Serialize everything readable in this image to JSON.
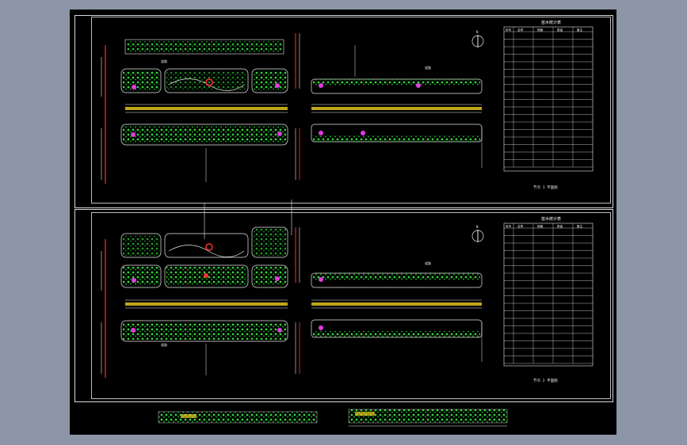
{
  "plans": [
    {
      "id": "upper",
      "north_symbol": "north-arrow",
      "legend_title": "苗木统计表",
      "legend_headers": [
        "序号",
        "名称",
        "规格",
        "数量",
        "备注"
      ],
      "legend_rows": 18,
      "caption": "节点 1 平面图",
      "road_labels": [
        "道路",
        "道路"
      ]
    },
    {
      "id": "lower",
      "north_symbol": "north-arrow",
      "legend_title": "苗木统计表",
      "legend_headers": [
        "序号",
        "名称",
        "规格",
        "数量",
        "备注"
      ],
      "legend_rows": 18,
      "caption": "节点 2 平面图",
      "road_labels": [
        "道路",
        "道路"
      ]
    }
  ],
  "colors": {
    "background": "#8d96a6",
    "canvas": "#000000",
    "frame": "#d8d8d8",
    "plant_green": "#36d13e",
    "plant_dark": "#138a1c",
    "accent_magenta": "#e03ce0",
    "accent_red": "#ff3030",
    "accent_yellow": "#f0d020",
    "line_white": "#e8e8e8"
  }
}
